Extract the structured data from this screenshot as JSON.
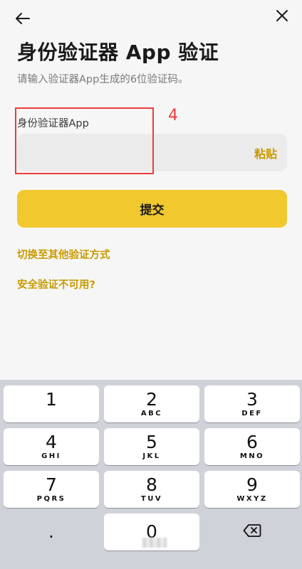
{
  "header": {
    "back_icon": "arrow-left-icon",
    "close_icon": "close-icon"
  },
  "main": {
    "title": "身份验证器 App 验证",
    "subtitle": "请输入验证器App生成的6位验证码。",
    "field_label": "身份验证器App",
    "input_value": "",
    "paste_label": "粘贴",
    "submit_label": "提交",
    "switch_method_link": "切换至其他验证方式",
    "unavailable_link": "安全验证不可用?"
  },
  "annotation": {
    "number": "4",
    "color": "#ee3b3b"
  },
  "keyboard": {
    "keys": [
      {
        "digit": "1",
        "letters": ""
      },
      {
        "digit": "2",
        "letters": "ABC"
      },
      {
        "digit": "3",
        "letters": "DEF"
      },
      {
        "digit": "4",
        "letters": "GHI"
      },
      {
        "digit": "5",
        "letters": "JKL"
      },
      {
        "digit": "6",
        "letters": "MNO"
      },
      {
        "digit": "7",
        "letters": "PQRS"
      },
      {
        "digit": "8",
        "letters": "TUV"
      },
      {
        "digit": "9",
        "letters": "WXYZ"
      }
    ],
    "dot_key": ".",
    "zero_key": "0",
    "delete_icon": "backspace-icon"
  },
  "colors": {
    "accent": "#f2c82f",
    "link": "#c99a00",
    "background": "#f6f6f6",
    "keyboard_bg": "#cfd2d8"
  }
}
